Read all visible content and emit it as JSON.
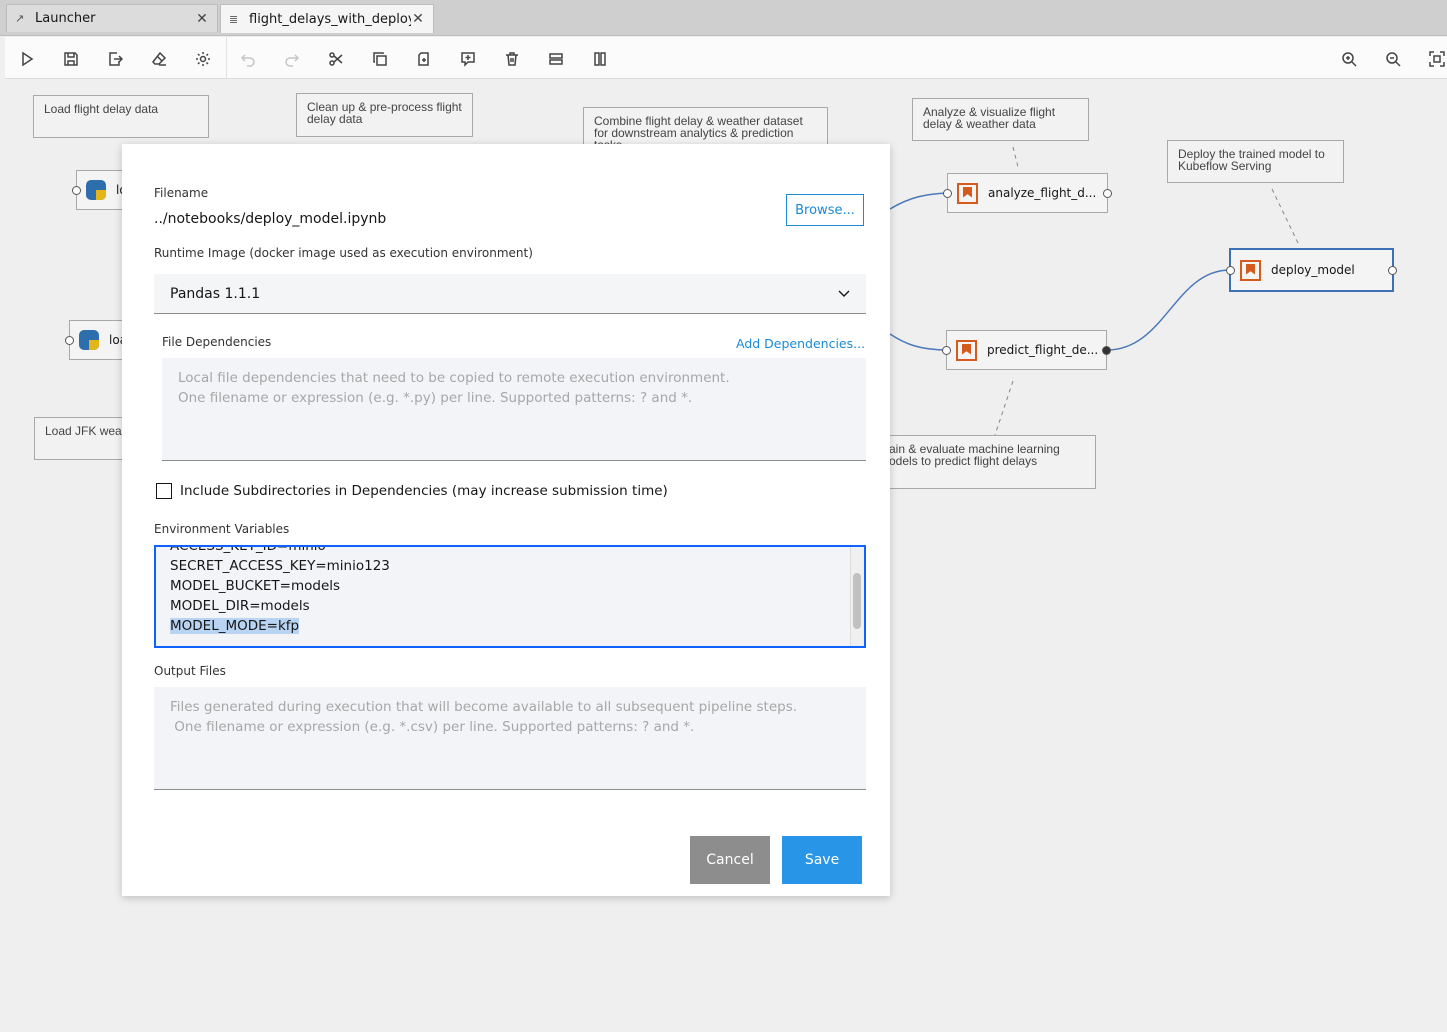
{
  "tabs": [
    {
      "label": "Launcher",
      "icon": "external-link-icon"
    },
    {
      "label": "flight_delays_with_deploym",
      "icon": "pipeline-icon"
    }
  ],
  "toolbar": {
    "left_buttons": [
      "run-icon",
      "save-icon",
      "export-icon",
      "clear-icon",
      "runtimes-icon",
      "undo-icon",
      "redo-icon",
      "cut-icon",
      "copy-icon",
      "paste-icon",
      "add-comment-icon",
      "delete-icon",
      "arrange-horizontal-icon",
      "arrange-vertical-icon"
    ],
    "right_buttons": [
      "zoom-in-icon",
      "zoom-out-icon",
      "fit-to-screen-icon"
    ]
  },
  "canvas": {
    "comments": [
      "Load flight delay data",
      "Clean up & pre-process flight delay data",
      "Combine flight delay & weather dataset for downstream analytics & prediction tasks",
      "Analyze & visualize flight delay & weather data",
      "Deploy the trained model to Kubeflow Serving",
      "Load JFK wea",
      "ain & evaluate machine learning\nodels to predict flight delays"
    ],
    "nodes": [
      {
        "label": "lo",
        "kind": "python"
      },
      {
        "label": "loa",
        "kind": "python"
      },
      {
        "label": "analyze_flight_d...",
        "kind": "notebook"
      },
      {
        "label": "predict_flight_de...",
        "kind": "notebook"
      },
      {
        "label": "deploy_model",
        "kind": "notebook"
      }
    ]
  },
  "dialog": {
    "filename_label": "Filename",
    "filename_value": "../notebooks/deploy_model.ipynb",
    "browse_label": "Browse...",
    "runtime_label": "Runtime Image (docker image used as execution environment)",
    "runtime_value": "Pandas 1.1.1",
    "file_deps_label": "File Dependencies",
    "add_deps_label": "Add Dependencies...",
    "file_deps_placeholder": "Local file dependencies that need to be copied to remote execution environment.\nOne filename or expression (e.g. *.py) per line. Supported patterns: ? and *.",
    "include_subdirs_label": "Include Subdirectories in Dependencies (may increase submission time)",
    "env_label": "Environment Variables",
    "env_lines": [
      "ACCESS_KEY_ID=minio",
      "SECRET_ACCESS_KEY=minio123",
      "MODEL_BUCKET=models",
      "MODEL_DIR=models",
      "MODEL_MODE=kfp"
    ],
    "output_label": "Output Files",
    "output_placeholder": "Files generated during execution that will become available to all subsequent pipeline steps.\n One filename or expression (e.g. *.csv) per line. Supported patterns: ? and *.",
    "cancel_label": "Cancel",
    "save_label": "Save"
  }
}
